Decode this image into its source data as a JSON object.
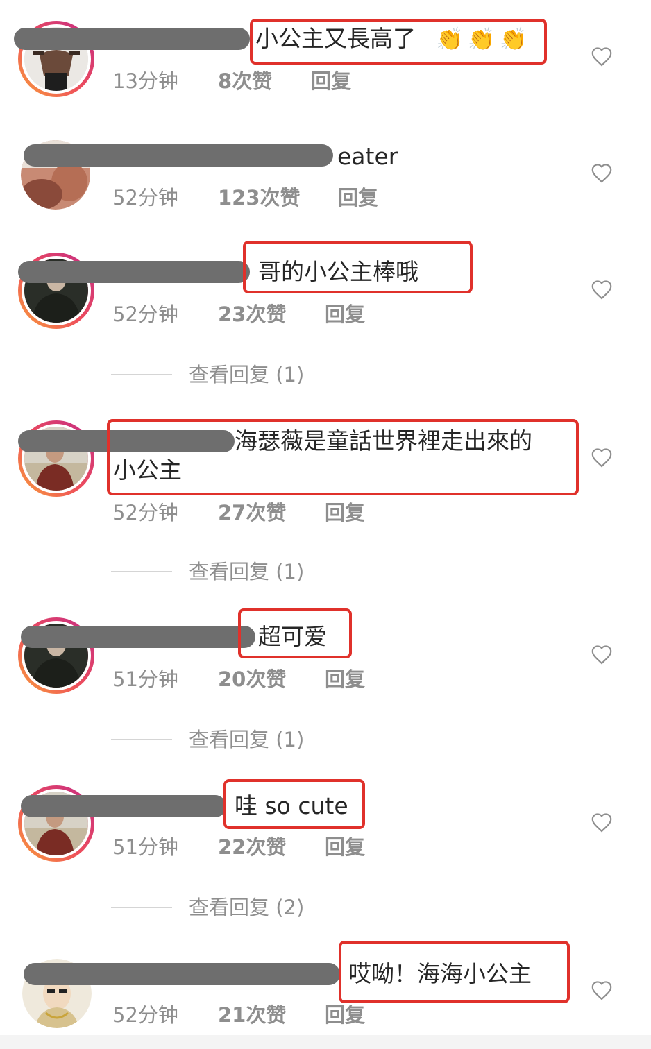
{
  "comments": [
    {
      "text": "小公主又長高了",
      "emoji": [
        "👏",
        "👏",
        "👏"
      ],
      "time": "13分钟",
      "likes": "8次赞",
      "reply": "回复",
      "like_icon": "heart-outline-icon"
    },
    {
      "text": "eater",
      "time": "52分钟",
      "likes": "123次赞",
      "reply": "回复",
      "like_icon": "heart-outline-icon"
    },
    {
      "text": "哥的小公主棒哦",
      "time": "52分钟",
      "likes": "23次赞",
      "reply": "回复",
      "view_replies": "查看回复 (1)",
      "like_icon": "heart-outline-icon"
    },
    {
      "text_line1": "海瑟薇是童話世界裡走出來的",
      "text_line2": "小公主",
      "time": "52分钟",
      "likes": "27次赞",
      "reply": "回复",
      "view_replies": "查看回复 (1)",
      "like_icon": "heart-outline-icon"
    },
    {
      "text": "超可爱",
      "time": "51分钟",
      "likes": "20次赞",
      "reply": "回复",
      "view_replies": "查看回复 (1)",
      "like_icon": "heart-outline-icon"
    },
    {
      "text": "哇 so cute",
      "time": "51分钟",
      "likes": "22次赞",
      "reply": "回复",
      "view_replies": "查看回复 (2)",
      "like_icon": "heart-outline-icon"
    },
    {
      "text": "哎呦！海海小公主",
      "time": "52分钟",
      "likes": "21次赞",
      "reply": "回复",
      "like_icon": "heart-outline-icon"
    }
  ],
  "colors": {
    "highlight_border": "#e0312b",
    "meta_text": "#8e8e8e",
    "redaction": "#6e6e6e"
  }
}
